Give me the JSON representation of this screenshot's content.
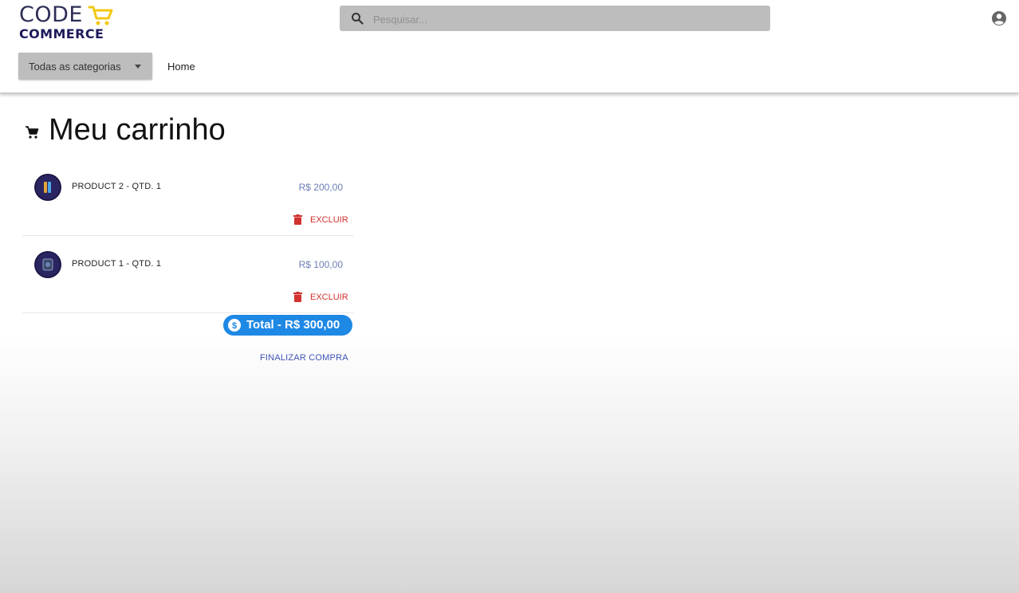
{
  "logo": {
    "line1": "CODE",
    "line2": "COMMERCE"
  },
  "search": {
    "placeholder": "Pesquisar..."
  },
  "nav": {
    "categories_label": "Todas as categorias",
    "home_label": "Home"
  },
  "page": {
    "title": "Meu carrinho"
  },
  "cart": {
    "items": [
      {
        "name": "PRODUCT 2 - QTD. 1",
        "price": "R$ 200,00",
        "delete_label": "EXCLUIR"
      },
      {
        "name": "PRODUCT 1 - QTD. 1",
        "price": "R$ 100,00",
        "delete_label": "EXCLUIR"
      }
    ],
    "total": "Total - R$ 300,00",
    "checkout_label": "FINALIZAR COMPRA"
  },
  "icons": {
    "logo_cart": "shopping-cart-icon",
    "search": "search-icon",
    "account": "account-circle-icon",
    "title": "shopping-cart-icon",
    "delete": "trash-icon",
    "total": "dollar-icon"
  },
  "colors": {
    "brand_navy": "#1d1a5c",
    "brand_yellow": "#f2c811",
    "price": "#6c7fb6",
    "delete": "#d0322f",
    "total_badge": "#1e88e5",
    "checkout": "#3f51b5"
  }
}
